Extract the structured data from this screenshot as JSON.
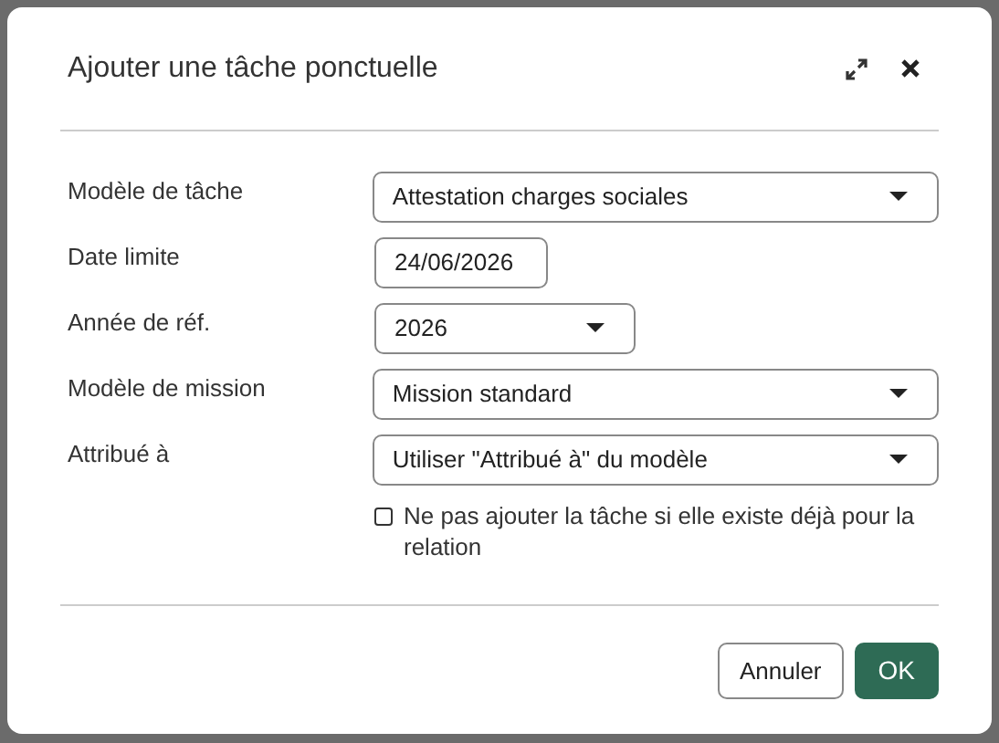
{
  "dialog": {
    "title": "Ajouter une tâche ponctuelle"
  },
  "fields": [
    {
      "kind": "select",
      "label": "Modèle de tâche",
      "value": "Attestation charges sociales"
    },
    {
      "kind": "date",
      "label": "Date limite",
      "value": "24/06/2026"
    },
    {
      "kind": "select",
      "label": "Année de réf.",
      "value": "2026"
    },
    {
      "kind": "select",
      "label": "Modèle de mission",
      "value": "Mission standard"
    },
    {
      "kind": "select",
      "label": "Attribué à",
      "value": "Utiliser \"Attribué à\" du modèle"
    }
  ],
  "option": {
    "label": "Ne pas ajouter la tâche si elle existe déjà pour la relation",
    "checked": false
  },
  "buttons": [
    {
      "label": "Annuler",
      "kind": "secondary"
    },
    {
      "label": "OK",
      "kind": "primary"
    }
  ]
}
